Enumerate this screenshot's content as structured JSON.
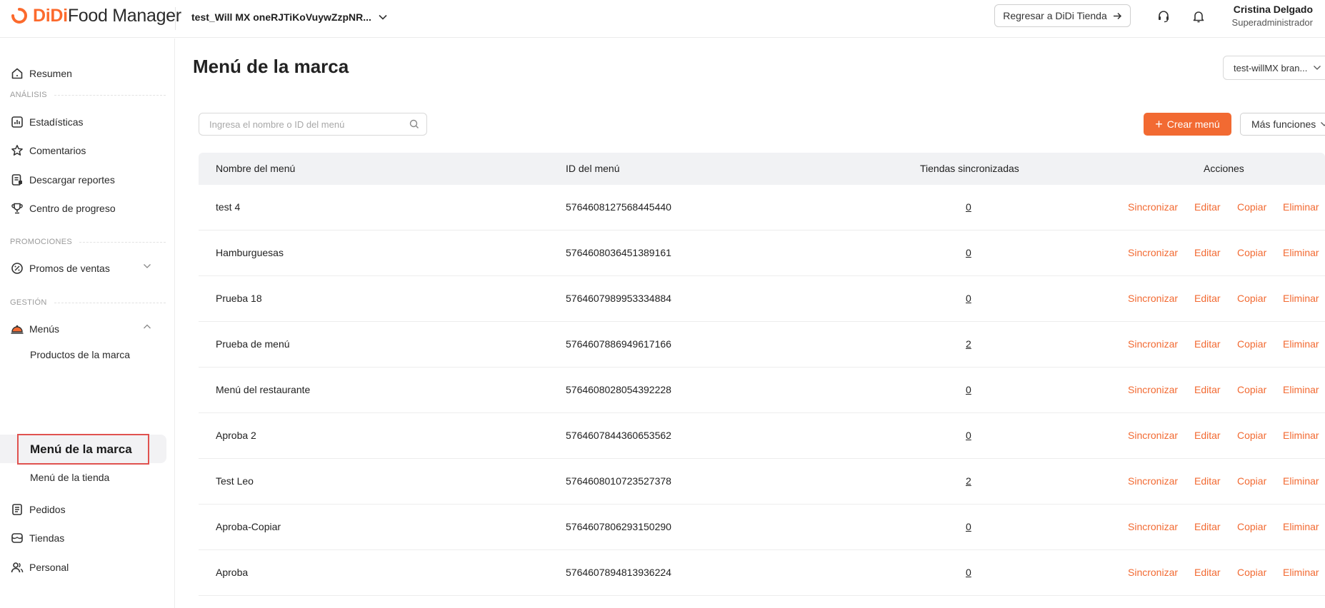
{
  "header": {
    "logo_brand": "DiDi",
    "logo_product": "Food Manager",
    "brand_selector": "test_Will MX oneRJTiKoVuywZzpNR...",
    "return_button": "Regresar a DiDi Tienda",
    "user_name": "Cristina Delgado",
    "user_role": "Superadministrador"
  },
  "sidebar": {
    "resumen": "Resumen",
    "section_analisis": "ANÁLISIS",
    "estadisticas": "Estadísticas",
    "comentarios": "Comentarios",
    "descargar_reportes": "Descargar reportes",
    "centro_progreso": "Centro de progreso",
    "section_promociones": "PROMOCIONES",
    "promos_ventas": "Promos de ventas",
    "section_gestion": "GESTIÓN",
    "menus": "Menús",
    "productos_marca": "Productos de la marca",
    "menu_marca": "Menú de la marca",
    "menu_tienda": "Menú de la tienda",
    "pedidos": "Pedidos",
    "tiendas": "Tiendas",
    "personal": "Personal"
  },
  "main": {
    "title": "Menú de la marca",
    "store_selector": "test-willMX bran...",
    "search_placeholder": "Ingresa el nombre o ID del menú",
    "create_button": "Crear menú",
    "more_button": "Más funciones",
    "columns": {
      "name": "Nombre del menú",
      "id": "ID del menú",
      "stores": "Tiendas sincronizadas",
      "actions": "Acciones"
    },
    "action_labels": {
      "sync": "Sincronizar",
      "edit": "Editar",
      "copy": "Copiar",
      "delete": "Eliminar"
    },
    "rows": [
      {
        "name": "test 4",
        "id": "5764608127568445440",
        "stores": "0"
      },
      {
        "name": "Hamburguesas",
        "id": "5764608036451389161",
        "stores": "0"
      },
      {
        "name": "Prueba 18",
        "id": "5764607989953334884",
        "stores": "0"
      },
      {
        "name": "Prueba de menú",
        "id": "5764607886949617166",
        "stores": "2"
      },
      {
        "name": "Menú del restaurante",
        "id": "5764608028054392228",
        "stores": "0"
      },
      {
        "name": "Aproba 2",
        "id": "5764607844360653562",
        "stores": "0"
      },
      {
        "name": "Test Leo",
        "id": "5764608010723527378",
        "stores": "2"
      },
      {
        "name": "Aproba-Copiar",
        "id": "5764607806293150290",
        "stores": "0"
      },
      {
        "name": "Aproba",
        "id": "5764607894813936224",
        "stores": "0"
      }
    ]
  },
  "colors": {
    "accent": "#f26a32",
    "highlight_border": "#e0524f"
  }
}
